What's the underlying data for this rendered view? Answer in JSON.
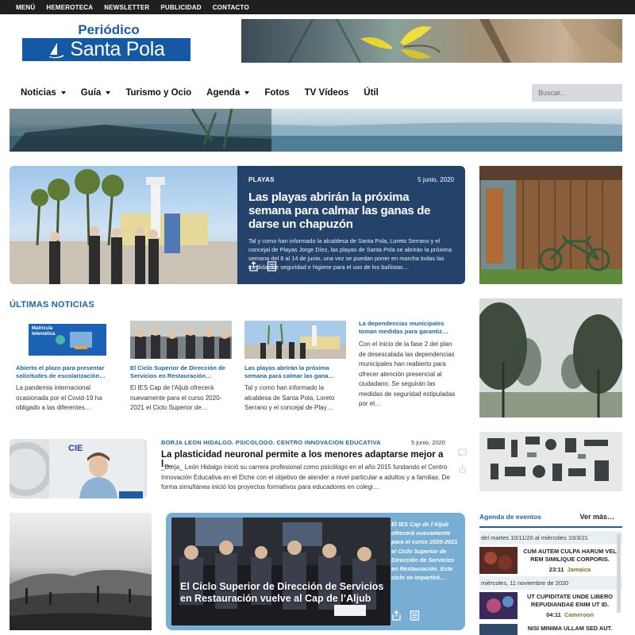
{
  "topbar": {
    "items": [
      "MENÚ",
      "HEMEROTECA",
      "NEWSLETTER",
      "PUBLICIDAD",
      "CONTACTO"
    ]
  },
  "logo": {
    "line1": "Periódico",
    "line2": "Santa Pola"
  },
  "nav": {
    "items": [
      {
        "label": "Noticias",
        "has_dropdown": true
      },
      {
        "label": "Guía",
        "has_dropdown": true
      },
      {
        "label": "Turismo y Ocio",
        "has_dropdown": false
      },
      {
        "label": "Agenda",
        "has_dropdown": true
      },
      {
        "label": "Fotos",
        "has_dropdown": false
      },
      {
        "label": "TV Vídeos",
        "has_dropdown": false
      },
      {
        "label": "Útil",
        "has_dropdown": false
      }
    ],
    "search_placeholder": "Buscar..."
  },
  "hero": {
    "category": "PLAYAS",
    "date": "5 junio, 2020",
    "title": "Las playas abrirán la próxima semana para calmar las ganas de darse un chapuzón",
    "text": "Tal y como han informado la alcaldesa de Santa Pola, Loreto Serrano y el concejal de Playas Jorge Díez, las playas de Santa Pola se abrirán la próxima semana del 8 al 14 de junio, una vez se puedan poner en marcha todas las medidas de seguridad e higiene para el uso de los bañistas…"
  },
  "latest": {
    "title": "ÚLTIMAS NOTICIAS",
    "items": [
      {
        "title": "Abierto el plazo para presentar solicitudes de escolarización…",
        "text": "La pandemia internacional ocasionada por el Covid-19 ha obligado a las diferentes…",
        "image_caption": "Matrícula telemática"
      },
      {
        "title": "El Ciclo Superior de Dirección de Servicios en Restauración…",
        "text": "El IES Cap de l'Aljub ofrecerá nuevamente para el curso 2020-2021 el Ciclo Superior de…"
      },
      {
        "title": "Las playas abrirán la próxima semana para calmar las gana…",
        "text": "Tal y como han informado la alcaldesa de Santa Pola, Loreto Serrano y el concejal de Play…"
      },
      {
        "title": "La dependencias municipales toman medidas para garantiz…",
        "text": "Con el inicio de la fase 2 del plan de desescalada las dependencias municipales han reabierto para ofrecer atención presencial al ciudadano. Se seguirán las medidas de seguridad estipuladas por el…"
      }
    ]
  },
  "article": {
    "category": "BORJA LEON HIDALGO. PSICOLOGO. CENTRO INNOVACION EDUCATIVA",
    "date": "5 junio, 2020",
    "title": "La plasticidad neuronal permite a los menores adaptarse mejor a l…",
    "text": "_Borja_ León Hidalgo inició su carrera profesional como psicólogo en el año 2015 fundando el Centro Innovación Educativa en el Elche con el objetivo de atender a nivel particular a adultos y a familias. De forma simultánea inició los proyectos formativos para educadores en colegi…",
    "image_logo": "CIE"
  },
  "featured": {
    "title": "El Ciclo Superior de Dirección de Servicios en Restauración vuelve al Cap de l’Aljub",
    "text": "El IES Cap de l’Aljub ofrecerá nuevamente para el curso 2020-2021 el Ciclo Superior de Dirección de Servicios en Restauración. Este ciclo se impartirá…"
  },
  "agenda": {
    "title": "Agenda de eventos",
    "more": "Ver más…",
    "groups": [
      {
        "date": "del martes 10/11/20 al miércoles 10/3/21",
        "events": [
          {
            "title": "CUM AUTEM CULPA HARUM VEL REM SIMILIQUE CORPORIS.",
            "time": "23:11",
            "place": "Jamaica"
          }
        ]
      },
      {
        "date": "miércoles, 11 noviembre de 2020",
        "events": [
          {
            "title": "UT CUPIDITATE UNDE LIBERO REPUDIANDAE ENIM UT ID.",
            "time": "04:11",
            "place": "Cameroon"
          },
          {
            "title": "NISI MINIMA ULLAM SED AUT.",
            "time": "",
            "place": ""
          }
        ]
      }
    ]
  },
  "colors": {
    "topbar": "#1f1f1f",
    "brand_blue": "#1558a4",
    "link_blue": "#1e63a6",
    "hero_panel": "#24436a",
    "featured_bg": "#78aed3"
  }
}
